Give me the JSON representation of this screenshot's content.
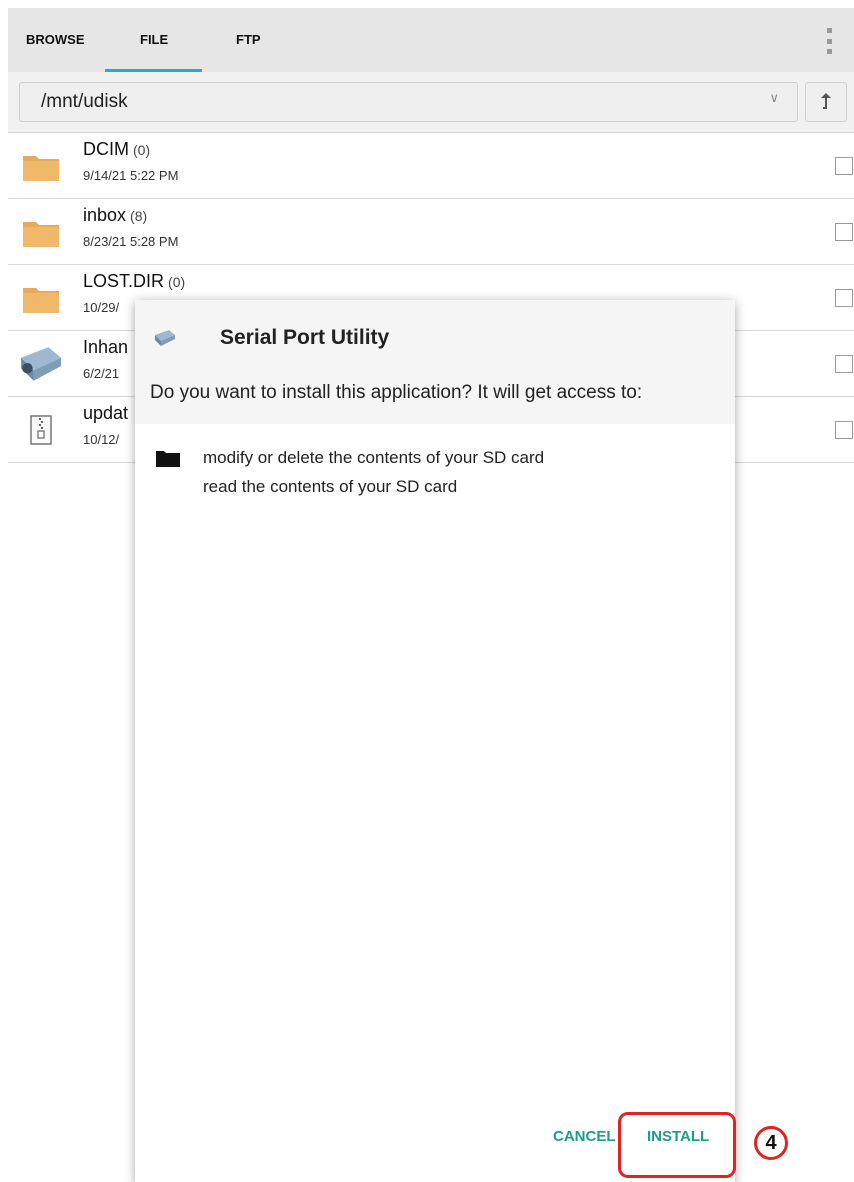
{
  "tabs": [
    {
      "label": "BROWSE"
    },
    {
      "label": "FILE"
    },
    {
      "label": "FTP"
    }
  ],
  "active_tab": "FILE",
  "colors": {
    "tab_indicator": "#2aa5d8",
    "folder": "#e8a958",
    "dialog_button": "#1a9e8a",
    "annotation_red": "#e02424"
  },
  "path": {
    "value": "/mnt/udisk"
  },
  "files": [
    {
      "name": "DCIM",
      "count": "(0)",
      "date": "9/14/21 5:22 PM",
      "icon": "folder-icon"
    },
    {
      "name": "inbox",
      "count": "(8)",
      "date": "8/23/21 5:28 PM",
      "icon": "folder-icon"
    },
    {
      "name": "LOST.DIR",
      "count": "(0)",
      "date": "10/29/",
      "icon": "folder-icon"
    },
    {
      "name": "Inhan",
      "count": "",
      "date": "6/2/21",
      "icon": "serial-port-icon"
    },
    {
      "name": "updat",
      "count": "",
      "date": "10/12/",
      "icon": "zip-file-icon"
    }
  ],
  "dialog": {
    "title": "Serial Port Utility",
    "question": "Do you want to install this application? It will get access to:",
    "permissions": [
      "modify or delete the contents of your SD card",
      "read the contents of your SD card"
    ],
    "cancel_label": "CANCEL",
    "install_label": "INSTALL"
  },
  "annotation": {
    "step": "4"
  }
}
